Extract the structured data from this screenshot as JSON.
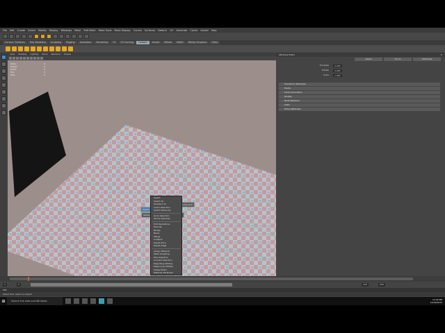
{
  "menubar": [
    "File",
    "Edit",
    "Create",
    "Select",
    "Modify",
    "Display",
    "Windows",
    "Mesh",
    "Edit Mesh",
    "Mesh Tools",
    "Mesh Display",
    "Curves",
    "Surfaces",
    "Deform",
    "UV",
    "Generate",
    "Cache",
    "Arnold",
    "Help"
  ],
  "shelf_tabs": [
    "Curves / Surfaces",
    "Poly Modeling",
    "Sculpting",
    "Rigging",
    "Animation",
    "Rendering",
    "FX",
    "FX Caching",
    "Custom",
    "Arnold",
    "Bifrost",
    "MASH",
    "Motion Graphics",
    "XGen"
  ],
  "shelf_active": "Custom",
  "viewport_menu": [
    "View",
    "Shading",
    "Lighting",
    "Show",
    "Renderer",
    "Panels"
  ],
  "hud": [
    {
      "label": "Verts:",
      "a": "",
      "b": "0"
    },
    {
      "label": "Edges:",
      "a": "",
      "b": "0"
    },
    {
      "label": "Faces:",
      "a": "",
      "b": "0"
    },
    {
      "label": "Tris:",
      "a": "",
      "b": "0"
    },
    {
      "label": "UVs:",
      "a": "",
      "b": "0"
    }
  ],
  "marking_menu": {
    "north": "Edge",
    "north_east": "Multi-Component",
    "east": "UV",
    "west": "Vertex Face",
    "south_east": "UVShell",
    "south": "Face",
    "center": "Vertex"
  },
  "context_menu": [
    "Select",
    "Select All",
    "Deselect All",
    "Invert Selection",
    "Select Hierarchy",
    "---",
    "Grow Selection",
    "Shrink Selection",
    "---",
    "Edit Operations",
    "Extrude",
    "Bridge",
    "Bevel",
    "Merge",
    "Collapse",
    "Delete Face",
    "Delete Edge",
    "---",
    "Assign Material",
    "Mesh Sculpting",
    "Poly Selection",
    "Convert Selection",
    "Edge Ring Utilities",
    "Edge Loop Utilities",
    "Shape Editor",
    "Material Attributes"
  ],
  "attribute_editor": {
    "title": "Attribute Editor",
    "tabs": [
      "Select",
      "Focus",
      "Attributes"
    ],
    "sections": [
      "Transform Attributes",
      "Pivots",
      "Limit Information",
      "Display",
      "Node Behavior",
      "UUID",
      "Extra Attributes"
    ],
    "fields": [
      {
        "label": "Translate",
        "value": "0.000"
      },
      {
        "label": "Rotate",
        "value": "0.000"
      },
      {
        "label": "Scale",
        "value": "1.000"
      }
    ]
  },
  "range": {
    "start": "1",
    "end": "120",
    "current": "1",
    "anim_end": "200"
  },
  "command_line": "MEL",
  "help_line": "Select Tool: select an object",
  "taskbar": {
    "search": "Search the web and Windows",
    "time": "12:40 PM",
    "date": "12/18/2015"
  }
}
